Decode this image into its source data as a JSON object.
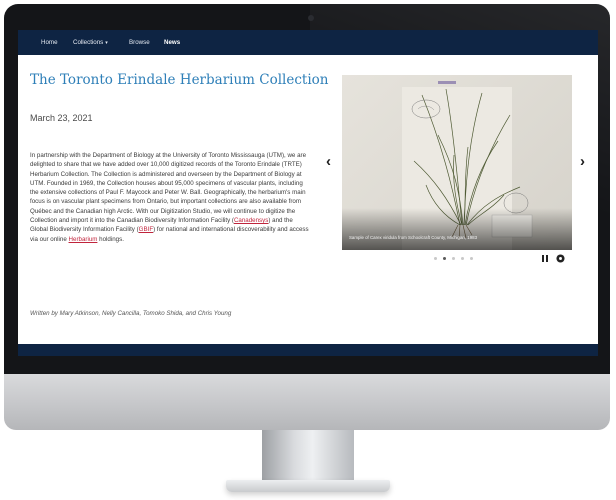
{
  "nav": {
    "items": [
      {
        "label": "Home",
        "active": false
      },
      {
        "label": "Collections",
        "active": false,
        "has_dropdown": true,
        "caret": "▾"
      },
      {
        "label": "Browse",
        "active": false
      },
      {
        "label": "News",
        "active": true
      }
    ]
  },
  "article": {
    "title": "The Toronto Erindale Herbarium Collection",
    "date": "March 23, 2021",
    "body_segments": {
      "p1": "In partnership with the Department of Biology at the University of Toronto Mississauga (UTM), we are delighted to share that we have added over 10,000 digitized records of the Toronto Erindale (TRTE) Herbarium Collection. The Collection is administered and overseen by the Department of Biology at UTM. Founded in 1969, the Collection houses about 95,000 specimens of vascular plants, including the extensive collections of Paul F. Maycock and Peter W. Ball. Geographically, the herbarium's main focus is on vascular plant specimens from Ontario, but important collections are also available from Québec and the Canadian high Arctic. With our Digitization Studio, we will continue to digitize the Collection and import it into the Canadian Biodiversity Information Facility (",
      "link1": "Canadensys",
      "p2": ") and the Global Biodiversity Information Facility (",
      "link2": "GBIF",
      "p3": ") for national and international discoverability and access via our online ",
      "link3": "Herbarium",
      "p4": " holdings."
    },
    "byline": "Written  by Mary Atkinson, Nelly Cancilla, Tomoko Shida, and Chris Young"
  },
  "carousel": {
    "caption": "Sample of Carex viridula from Schoolcraft County, Michigan, 1983",
    "prev_glyph": "‹",
    "next_glyph": "›",
    "slide_count": 5,
    "active_slide": 2
  },
  "colors": {
    "navbar": "#0e2443",
    "title": "#2e7fb8",
    "link": "#c0243c"
  },
  "icons": [
    "chevron-left-icon",
    "chevron-right-icon",
    "pause-icon",
    "settings-icon"
  ]
}
